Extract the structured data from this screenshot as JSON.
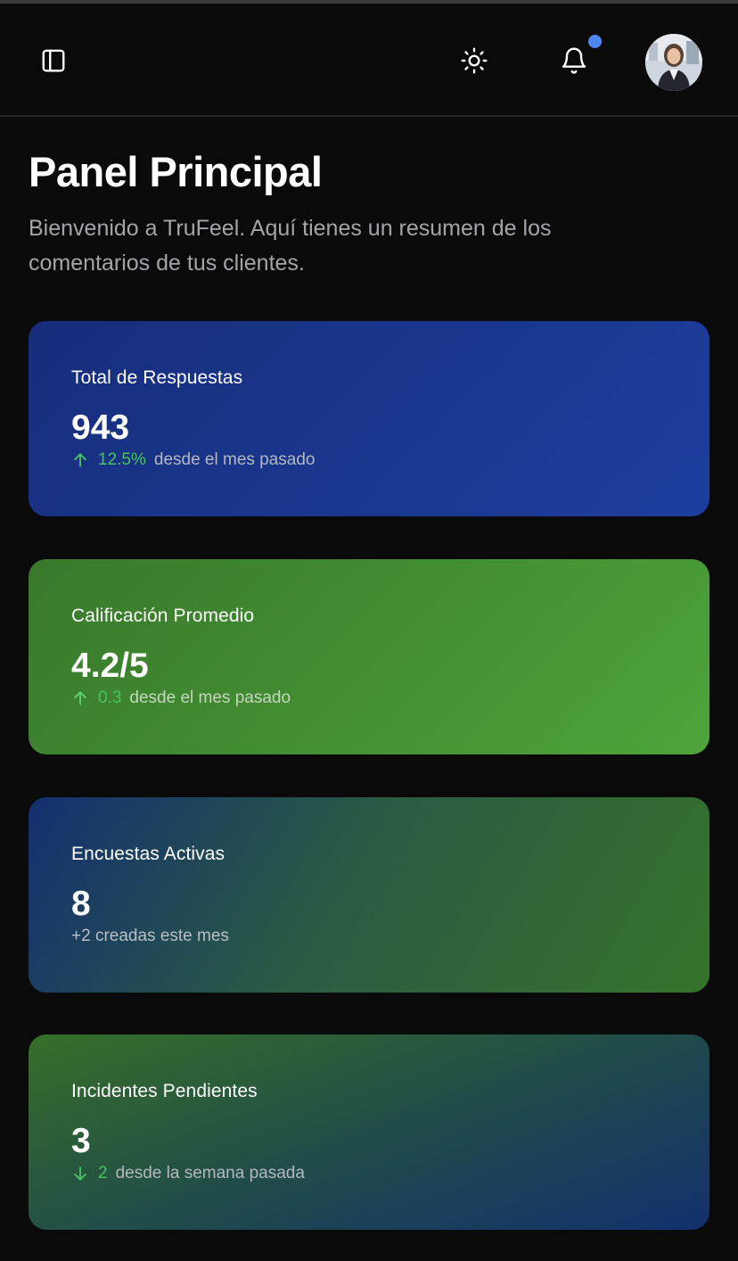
{
  "header": {
    "sidebar_toggle_icon": "sidebar-toggle-icon",
    "theme_icon": "sun-icon",
    "notification_icon": "bell-icon",
    "notification_dot_color": "#4f86f7",
    "avatar_icon": "user-avatar"
  },
  "main": {
    "title": "Panel Principal",
    "subtitle": "Bienvenido a TruFeel. Aquí tienes un resumen de los comentarios de tus clientes."
  },
  "cards": [
    {
      "label": "Total de Respuestas",
      "value": "943",
      "trend_icon": "arrow-up-icon",
      "delta": "12.5%",
      "since": "desde el mes pasado"
    },
    {
      "label": "Calificación Promedio",
      "value": "4.2/5",
      "trend_icon": "arrow-up-icon",
      "delta": "0.3",
      "since": "desde el mes pasado"
    },
    {
      "label": "Encuestas Activas",
      "value": "8",
      "note": "+2 creadas este mes"
    },
    {
      "label": "Incidentes Pendientes",
      "value": "3",
      "trend_icon": "arrow-down-icon",
      "delta": "2",
      "since": "desde la semana pasada"
    }
  ],
  "colors": {
    "background": "#0a0a0b",
    "positive": "#4cc361",
    "card_blue": "#1c3f9e",
    "card_green": "#4ea43a"
  }
}
